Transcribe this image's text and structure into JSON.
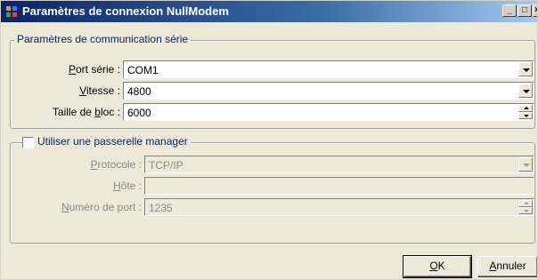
{
  "window": {
    "title": "Paramètres de connexion NullModem",
    "app_icon": "app-icon",
    "min_label": "_",
    "max_label": "□",
    "close_label": "×"
  },
  "serial_group": {
    "legend": "Paramètres de communication série",
    "port": {
      "label_prefix": "",
      "label_u": "P",
      "label_rest": "ort série :",
      "value": "COM1"
    },
    "speed": {
      "label_u": "V",
      "label_rest": "itesse :",
      "value": "4800"
    },
    "block": {
      "label_prefix": "Taille de ",
      "label_u": "b",
      "label_rest": "loc :",
      "value": "6000"
    }
  },
  "gateway_group": {
    "checkbox_label": "Utiliser une passerelle manager",
    "checked": false,
    "protocol": {
      "label_u": "P",
      "label_rest": "rotocole :",
      "value": "TCP/IP"
    },
    "host": {
      "label_u": "H",
      "label_rest": "ôte :",
      "value": ""
    },
    "port": {
      "label_u": "N",
      "label_rest": "uméro de port :",
      "value": "1235"
    }
  },
  "buttons": {
    "ok": {
      "u": "O",
      "rest": "K"
    },
    "cancel": {
      "u": "A",
      "rest": "nnuler"
    }
  }
}
